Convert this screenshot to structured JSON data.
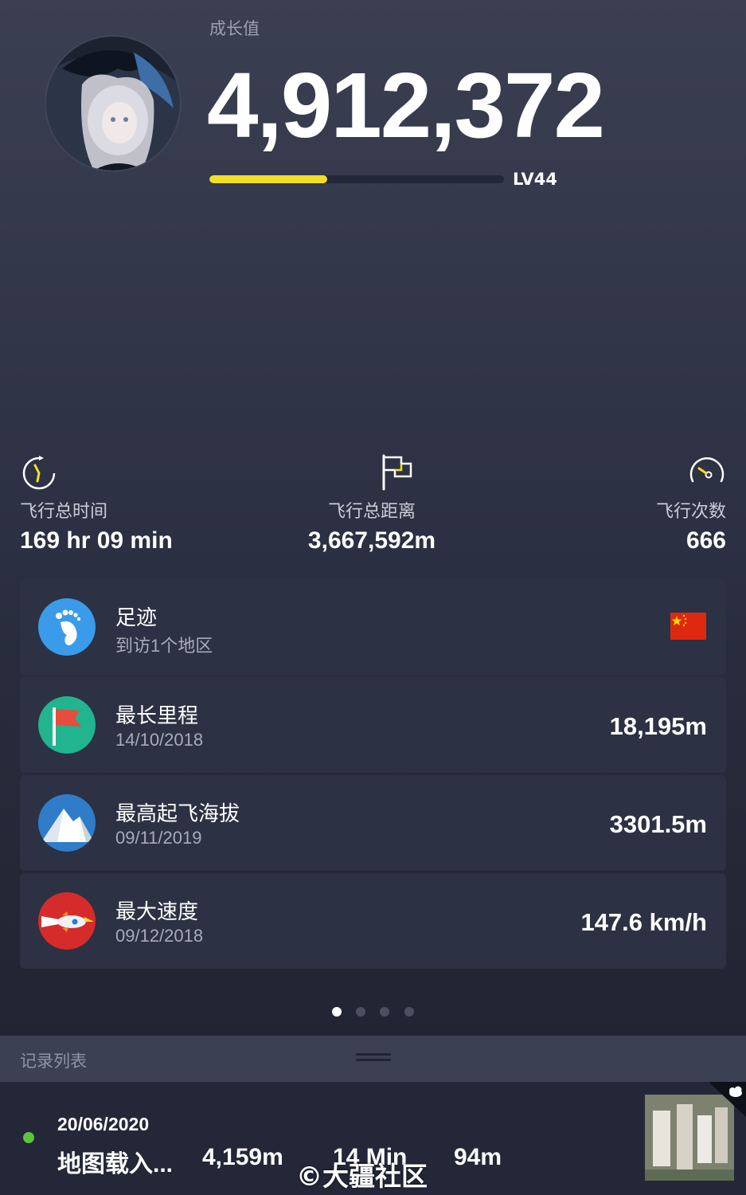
{
  "header": {
    "growth_label": "成长值",
    "growth_value": "4,912,372",
    "progress_fraction": 0.4,
    "level": "LV44"
  },
  "stats": [
    {
      "label": "飞行总时间",
      "value": "169 hr 09 min",
      "icon": "timer-icon"
    },
    {
      "label": "飞行总距离",
      "value": "3,667,592m",
      "icon": "flag-outline-icon"
    },
    {
      "label": "飞行次数",
      "value": "666",
      "icon": "speedometer-icon"
    }
  ],
  "cards": [
    {
      "title": "足迹",
      "sub": "到访1个地区",
      "value": "",
      "icon": "footprint-icon",
      "flag": "china-flag"
    },
    {
      "title": "最长里程",
      "sub": "14/10/2018",
      "value": "18,195m",
      "icon": "red-flag-icon"
    },
    {
      "title": "最高起飞海拔",
      "sub": "09/11/2019",
      "value": "3301.5m",
      "icon": "mountain-icon"
    },
    {
      "title": "最大速度",
      "sub": "09/12/2018",
      "value": "147.6 km/h",
      "icon": "rocket-icon"
    }
  ],
  "pagination": {
    "total": 4,
    "active": 0
  },
  "records": {
    "title": "记录列表",
    "items": [
      {
        "date": "20/06/2020",
        "name": "地图载入...",
        "distance": "4,159m",
        "duration": "14 Min",
        "altitude": "94m"
      }
    ]
  },
  "watermark": "©大疆社区",
  "colors": {
    "accent_yellow": "#f3df26",
    "status_green": "#5cc43c",
    "card_bg": "#2c3143"
  }
}
